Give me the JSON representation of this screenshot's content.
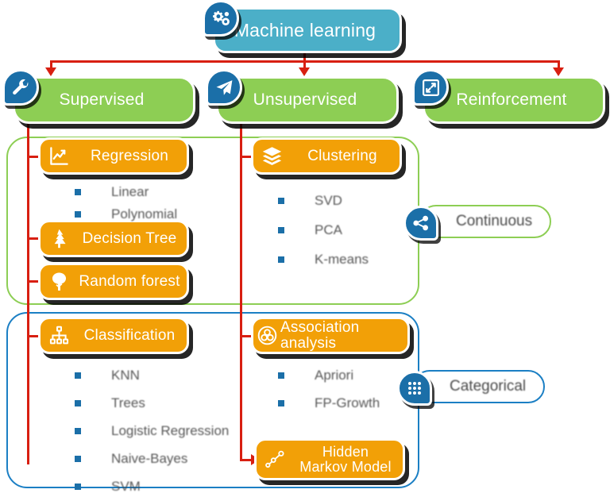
{
  "diagram": {
    "title": "Machine learning",
    "root": {
      "label": "Machine learning",
      "icon": "gears-icon",
      "color": "#4BAFC8"
    },
    "categories": [
      {
        "label": "Supervised",
        "icon": "wrench-icon",
        "color": "#8DCE54"
      },
      {
        "label": "Unsupervised",
        "icon": "paper-plane-icon",
        "color": "#8DCE54"
      },
      {
        "label": "Reinforcement",
        "icon": "compress-arrows-icon",
        "color": "#8DCE54"
      }
    ],
    "groups": [
      {
        "name": "continuous-group",
        "color": "#8DCE54"
      },
      {
        "name": "categorical-group",
        "color": "#1B7FC4"
      }
    ],
    "pins": [
      {
        "label": "Continuous",
        "icon": "share-network-icon",
        "color": "#8DCE54"
      },
      {
        "label": "Categorical",
        "icon": "grid-dots-icon",
        "color": "#1B7FC4"
      }
    ],
    "nodes": [
      {
        "label": "Regression",
        "icon": "chart-line-icon",
        "color": "#F2A007",
        "items": [
          "Linear",
          "Polynomial"
        ]
      },
      {
        "label": "Decision Tree",
        "icon": "pine-tree-icon",
        "color": "#F2A007",
        "items": []
      },
      {
        "label": "Random forest",
        "icon": "tree-icon",
        "color": "#F2A007",
        "items": []
      },
      {
        "label": "Classification",
        "icon": "sitemap-icon",
        "color": "#F2A007",
        "items": [
          "KNN",
          "Trees",
          "Logistic Regression",
          "Naive-Bayes",
          "SVM"
        ]
      },
      {
        "label": "Clustering",
        "icon": "layers-icon",
        "color": "#F2A007",
        "items": [
          "SVD",
          "PCA",
          "K-means"
        ]
      },
      {
        "label": "Association analysis",
        "icon": "association-circle-icon",
        "color": "#F2A007",
        "items": [
          "Apriori",
          "FP-Growth"
        ]
      },
      {
        "label": "Hidden\nMarkov Model",
        "label_line1": "Hidden",
        "label_line2": "Markov Model",
        "icon": "nodes-path-icon",
        "color": "#F2A007",
        "items": []
      }
    ],
    "connector_color": "#D81F11"
  }
}
